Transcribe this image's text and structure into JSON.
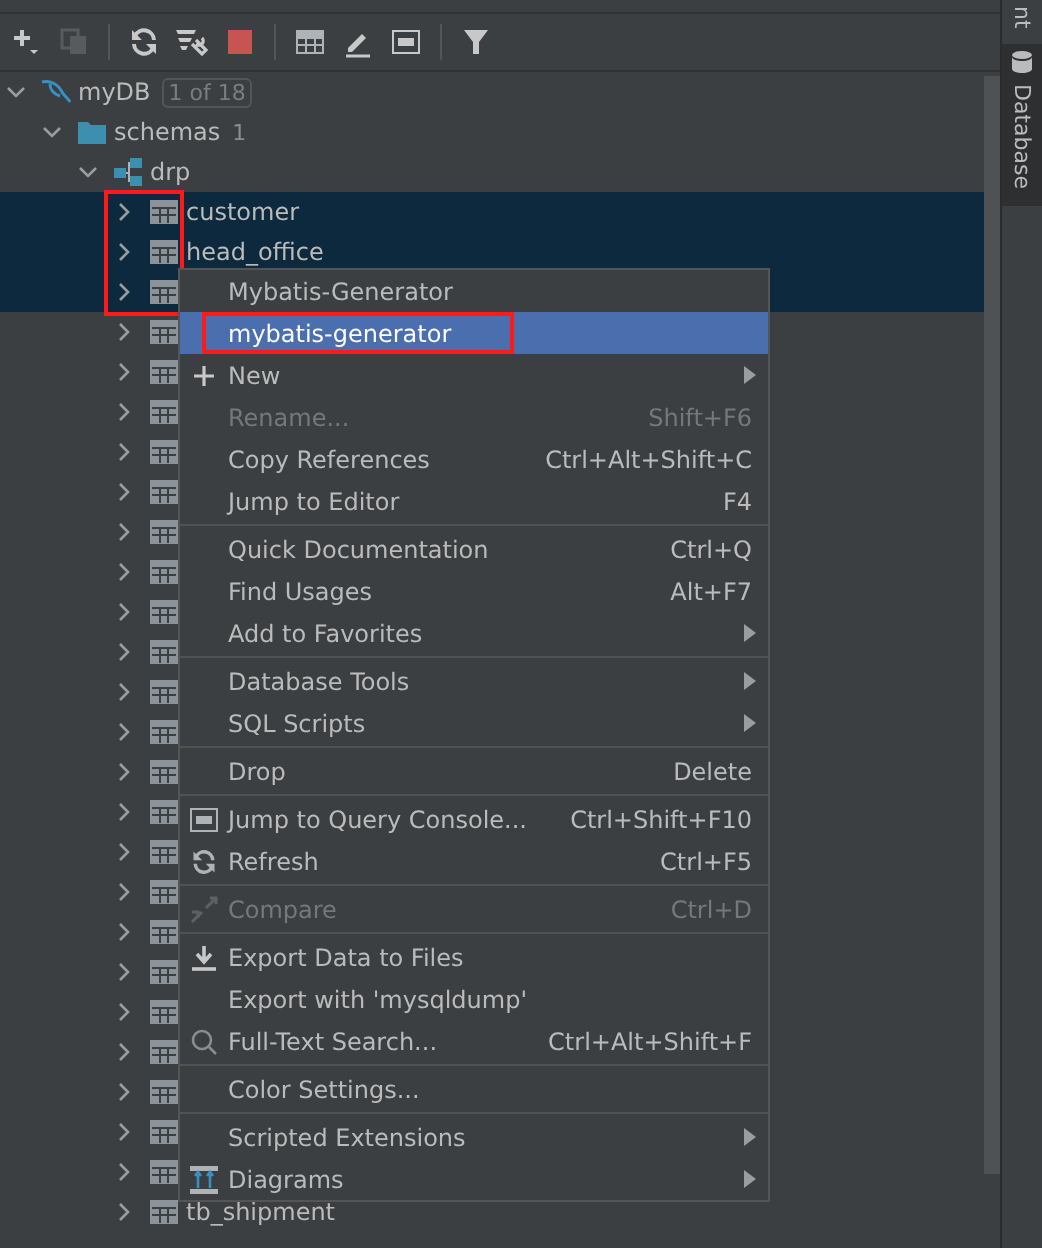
{
  "toolbar": {
    "buttons": [
      {
        "kind": "add",
        "disabled": false
      },
      {
        "kind": "copy",
        "disabled": true
      },
      {
        "kind": "sep"
      },
      {
        "kind": "refresh",
        "disabled": false
      },
      {
        "kind": "settings",
        "disabled": false
      },
      {
        "kind": "stop",
        "disabled": false
      },
      {
        "kind": "sep"
      },
      {
        "kind": "table",
        "disabled": false
      },
      {
        "kind": "edit",
        "disabled": false
      },
      {
        "kind": "console",
        "disabled": false
      },
      {
        "kind": "sep"
      },
      {
        "kind": "filter",
        "disabled": false
      }
    ]
  },
  "tree": [
    {
      "kind": "datasource",
      "label": "myDB",
      "badge": "1 of 18",
      "expanded": true,
      "children": [
        {
          "kind": "folder",
          "label": "schemas",
          "count": "1",
          "expanded": true,
          "children": [
            {
              "kind": "schema",
              "label": "drp",
              "expanded": true,
              "children": [
                {
                  "kind": "table",
                  "label": "customer",
                  "expanded": false,
                  "selected": true,
                  "highlighted": true
                },
                {
                  "kind": "table",
                  "label": "head_office",
                  "expanded": false,
                  "selected": true,
                  "highlighted": true
                },
                {
                  "kind": "table",
                  "expanded": false,
                  "selected": true,
                  "highlighted": true
                },
                {
                  "kind": "table",
                  "expanded": false,
                  "selected": false,
                  "highlighted": false
                },
                {
                  "kind": "table",
                  "expanded": false,
                  "selected": false,
                  "highlighted": false
                },
                {
                  "kind": "table",
                  "expanded": false,
                  "selected": false,
                  "highlighted": false
                },
                {
                  "kind": "table",
                  "expanded": false,
                  "selected": false,
                  "highlighted": false
                },
                {
                  "kind": "table",
                  "expanded": false,
                  "selected": false,
                  "highlighted": false
                },
                {
                  "kind": "table",
                  "expanded": false,
                  "selected": false,
                  "highlighted": false
                },
                {
                  "kind": "table",
                  "expanded": false,
                  "selected": false,
                  "highlighted": false
                },
                {
                  "kind": "table",
                  "expanded": false,
                  "selected": false,
                  "highlighted": false
                },
                {
                  "kind": "table",
                  "expanded": false,
                  "selected": false,
                  "highlighted": false
                },
                {
                  "kind": "table",
                  "expanded": false,
                  "selected": false,
                  "highlighted": false
                },
                {
                  "kind": "table",
                  "expanded": false,
                  "selected": false,
                  "highlighted": false
                },
                {
                  "kind": "table",
                  "expanded": false,
                  "selected": false,
                  "highlighted": false
                },
                {
                  "kind": "table",
                  "expanded": false,
                  "selected": false,
                  "highlighted": false
                },
                {
                  "kind": "table",
                  "expanded": false,
                  "selected": false,
                  "highlighted": false
                },
                {
                  "kind": "table",
                  "expanded": false,
                  "selected": false,
                  "highlighted": false
                },
                {
                  "kind": "table",
                  "expanded": false,
                  "selected": false,
                  "highlighted": false
                },
                {
                  "kind": "table",
                  "expanded": false,
                  "selected": false,
                  "highlighted": false
                },
                {
                  "kind": "table",
                  "expanded": false,
                  "selected": false,
                  "highlighted": false
                },
                {
                  "kind": "table",
                  "expanded": false,
                  "selected": false,
                  "highlighted": false
                },
                {
                  "kind": "table",
                  "expanded": false,
                  "selected": false,
                  "highlighted": false
                },
                {
                  "kind": "table",
                  "expanded": false,
                  "selected": false,
                  "highlighted": false
                },
                {
                  "kind": "table",
                  "expanded": false,
                  "selected": false,
                  "highlighted": false
                },
                {
                  "kind": "table",
                  "label": "tb_shipment",
                  "expanded": false,
                  "selected": false,
                  "highlighted": false
                }
              ]
            }
          ]
        }
      ]
    }
  ],
  "context_menu": {
    "items": [
      {
        "kind": "item",
        "label": "Mybatis-Generator",
        "selected": false,
        "disabled": false,
        "highlighted": false
      },
      {
        "kind": "item",
        "label": "mybatis-generator",
        "selected": true,
        "disabled": false,
        "highlighted": true
      },
      {
        "kind": "new",
        "label": "New",
        "submenu": true,
        "selected": false,
        "disabled": false,
        "highlighted": false
      },
      {
        "kind": "item",
        "label": "Rename...",
        "shortcut": "Shift+F6",
        "selected": false,
        "disabled": true,
        "highlighted": false
      },
      {
        "kind": "item",
        "label": "Copy References",
        "shortcut": "Ctrl+Alt+Shift+C",
        "selected": false,
        "disabled": false,
        "highlighted": false
      },
      {
        "kind": "item",
        "label": "Jump to Editor",
        "shortcut": "F4",
        "selected": false,
        "disabled": false,
        "highlighted": false
      },
      {
        "kind": "separator"
      },
      {
        "kind": "item",
        "label": "Quick Documentation",
        "shortcut": "Ctrl+Q",
        "selected": false,
        "disabled": false,
        "highlighted": false
      },
      {
        "kind": "item",
        "label": "Find Usages",
        "shortcut": "Alt+F7",
        "selected": false,
        "disabled": false,
        "highlighted": false
      },
      {
        "kind": "item",
        "label": "Add to Favorites",
        "submenu": true,
        "selected": false,
        "disabled": false,
        "highlighted": false
      },
      {
        "kind": "separator"
      },
      {
        "kind": "item",
        "label": "Database Tools",
        "submenu": true,
        "selected": false,
        "disabled": false,
        "highlighted": false
      },
      {
        "kind": "item",
        "label": "SQL Scripts",
        "submenu": true,
        "selected": false,
        "disabled": false,
        "highlighted": false
      },
      {
        "kind": "separator"
      },
      {
        "kind": "item",
        "label": "Drop",
        "shortcut": "Delete",
        "selected": false,
        "disabled": false,
        "highlighted": false
      },
      {
        "kind": "separator"
      },
      {
        "kind": "console",
        "label": "Jump to Query Console...",
        "shortcut": "Ctrl+Shift+F10",
        "selected": false,
        "disabled": false,
        "highlighted": false
      },
      {
        "kind": "refresh",
        "label": "Refresh",
        "shortcut": "Ctrl+F5",
        "selected": false,
        "disabled": false,
        "highlighted": false
      },
      {
        "kind": "separator"
      },
      {
        "kind": "compare",
        "label": "Compare",
        "shortcut": "Ctrl+D",
        "selected": false,
        "disabled": true,
        "highlighted": false
      },
      {
        "kind": "separator"
      },
      {
        "kind": "export",
        "label": "Export Data to Files",
        "selected": false,
        "disabled": false,
        "highlighted": false
      },
      {
        "kind": "item",
        "label": "Export with 'mysqldump'",
        "selected": false,
        "disabled": false,
        "highlighted": false
      },
      {
        "kind": "search",
        "label": "Full-Text Search...",
        "shortcut": "Ctrl+Alt+Shift+F",
        "selected": false,
        "disabled": false,
        "highlighted": false
      },
      {
        "kind": "separator"
      },
      {
        "kind": "item",
        "label": "Color Settings...",
        "selected": false,
        "disabled": false,
        "highlighted": false
      },
      {
        "kind": "separator"
      },
      {
        "kind": "item",
        "label": "Scripted Extensions",
        "submenu": true,
        "selected": false,
        "disabled": false,
        "highlighted": false
      },
      {
        "kind": "diagrams",
        "label": "Diagrams",
        "submenu": true,
        "selected": false,
        "disabled": false,
        "highlighted": false
      }
    ]
  },
  "side_strip": {
    "tabs": [
      {
        "label": "nt",
        "selected": false
      },
      {
        "label": "Database",
        "selected": true
      }
    ]
  }
}
